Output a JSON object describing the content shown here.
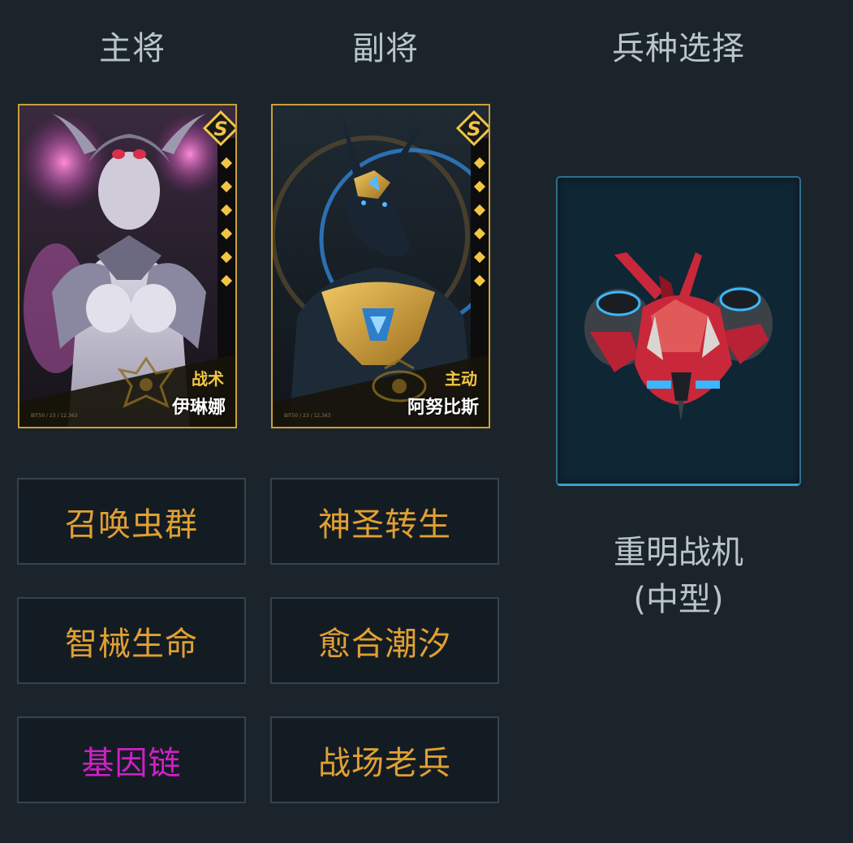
{
  "headers": {
    "main_general": "主将",
    "vice_general": "副将",
    "unit_select": "兵种选择"
  },
  "main_card": {
    "name": "伊琳娜",
    "type": "战术",
    "rank": "S",
    "stars": 6,
    "code": "BIT50 / 23 / 12,363",
    "accent": "#f2c644"
  },
  "vice_card": {
    "name": "阿努比斯",
    "type": "主动",
    "rank": "S",
    "stars": 6,
    "code": "BIT50 / 23 / 12,363",
    "accent": "#f2c644"
  },
  "main_skills": [
    {
      "label": "召唤虫群",
      "color": "#e0a033"
    },
    {
      "label": "智械生命",
      "color": "#e0a033"
    },
    {
      "label": "基因链",
      "color": "#cf20c8"
    }
  ],
  "vice_skills": [
    {
      "label": "神圣转生",
      "color": "#e0a033"
    },
    {
      "label": "愈合潮汐",
      "color": "#e0a033"
    },
    {
      "label": "战场老兵",
      "color": "#e0a033"
    }
  ],
  "unit": {
    "name_line1": "重明战机",
    "name_line2": "(中型)",
    "icon": "red-fighter-ship-icon"
  }
}
